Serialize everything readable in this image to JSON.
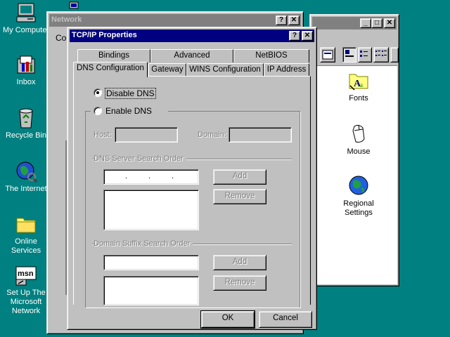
{
  "desktop": {
    "icons": [
      {
        "label": "My Computer",
        "icon": "computer-icon"
      },
      {
        "label": "Inbox",
        "icon": "inbox-icon"
      },
      {
        "label": "Recycle Bin",
        "icon": "recycle-bin-icon"
      },
      {
        "label": "The Internet",
        "icon": "internet-icon"
      },
      {
        "label": "Online Services",
        "icon": "folder-icon"
      },
      {
        "label": "Set Up The Microsoft Network",
        "icon": "msn-icon"
      }
    ]
  },
  "control_panel": {
    "items": [
      {
        "label": "Fonts",
        "icon": "fonts-folder-icon"
      },
      {
        "label": "Mouse",
        "icon": "mouse-icon"
      },
      {
        "label": "Regional Settings",
        "icon": "globe-icon"
      }
    ],
    "controls": {
      "minimize": "_",
      "maximize": "□",
      "close": "✕"
    }
  },
  "network": {
    "title": "Network",
    "help": "?",
    "close": "✕"
  },
  "tcpip": {
    "title": "TCP/IP Properties",
    "help": "?",
    "close": "✕",
    "tabs_back": [
      "Bindings",
      "Advanced",
      "NetBIOS"
    ],
    "tabs_front": [
      "DNS Configuration",
      "Gateway",
      "WINS Configuration",
      "IP Address"
    ],
    "disable_dns": "Disable DNS",
    "enable_dns": "Enable DNS",
    "host_label": "Host:",
    "domain_label": "Domain:",
    "dns_order_label": "DNS Server Search Order",
    "suffix_order_label": "Domain Suffix Search Order",
    "ip_separator": ".",
    "add": "Add",
    "remove": "Remove",
    "ok": "OK",
    "cancel": "Cancel"
  }
}
